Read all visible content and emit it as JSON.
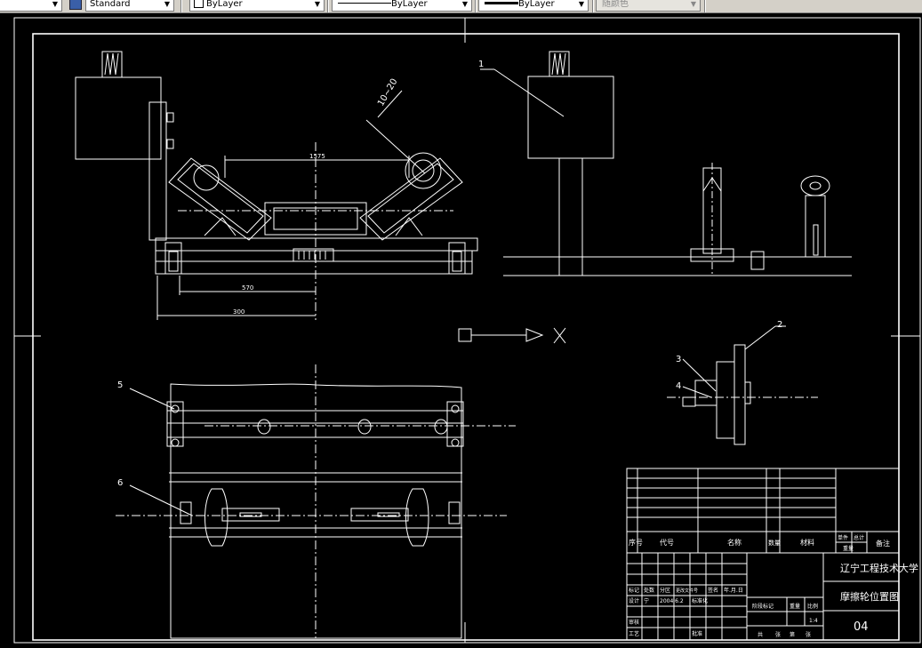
{
  "toolbar": {
    "text_style": "Standard",
    "layer": "ByLayer",
    "linetype": "ByLayer",
    "lineweight": "ByLayer",
    "plot_style": "随颜色"
  },
  "drawing": {
    "callouts": [
      "1",
      "2",
      "3",
      "4",
      "5",
      "6"
    ],
    "dimensions": {
      "angle": "10~20",
      "width": "1575",
      "offset": "570",
      "span": "300"
    },
    "axis_label": "X",
    "title_block": {
      "school": "辽宁工程技术大学",
      "drawing_title": "摩擦轮位置图",
      "sheet_no": "04",
      "scale": "1:4",
      "header": {
        "seq": "序号",
        "code": "代号",
        "name": "名称",
        "qty": "数量",
        "material": "材料",
        "single": "单件",
        "total": "总计",
        "weight": "重量",
        "remark": "备注"
      },
      "sign_rows": [
        [
          "标记",
          "处数",
          "分区",
          "更改文件号",
          "签名",
          "年.月.日"
        ],
        [
          "设计",
          "宁",
          "2004.6.2",
          "标准化",
          "",
          ""
        ],
        [
          "审核",
          "",
          "",
          "",
          "",
          ""
        ],
        [
          "工艺",
          "",
          "",
          "批准",
          "",
          ""
        ]
      ],
      "stage_labels": [
        "阶段标记",
        "重量",
        "比例"
      ],
      "sheet_labels": [
        "共",
        "张",
        "第",
        "张"
      ]
    }
  },
  "colors": {
    "background": "#000000",
    "lines": "#ffffff",
    "toolbar": "#d4d0c8"
  }
}
